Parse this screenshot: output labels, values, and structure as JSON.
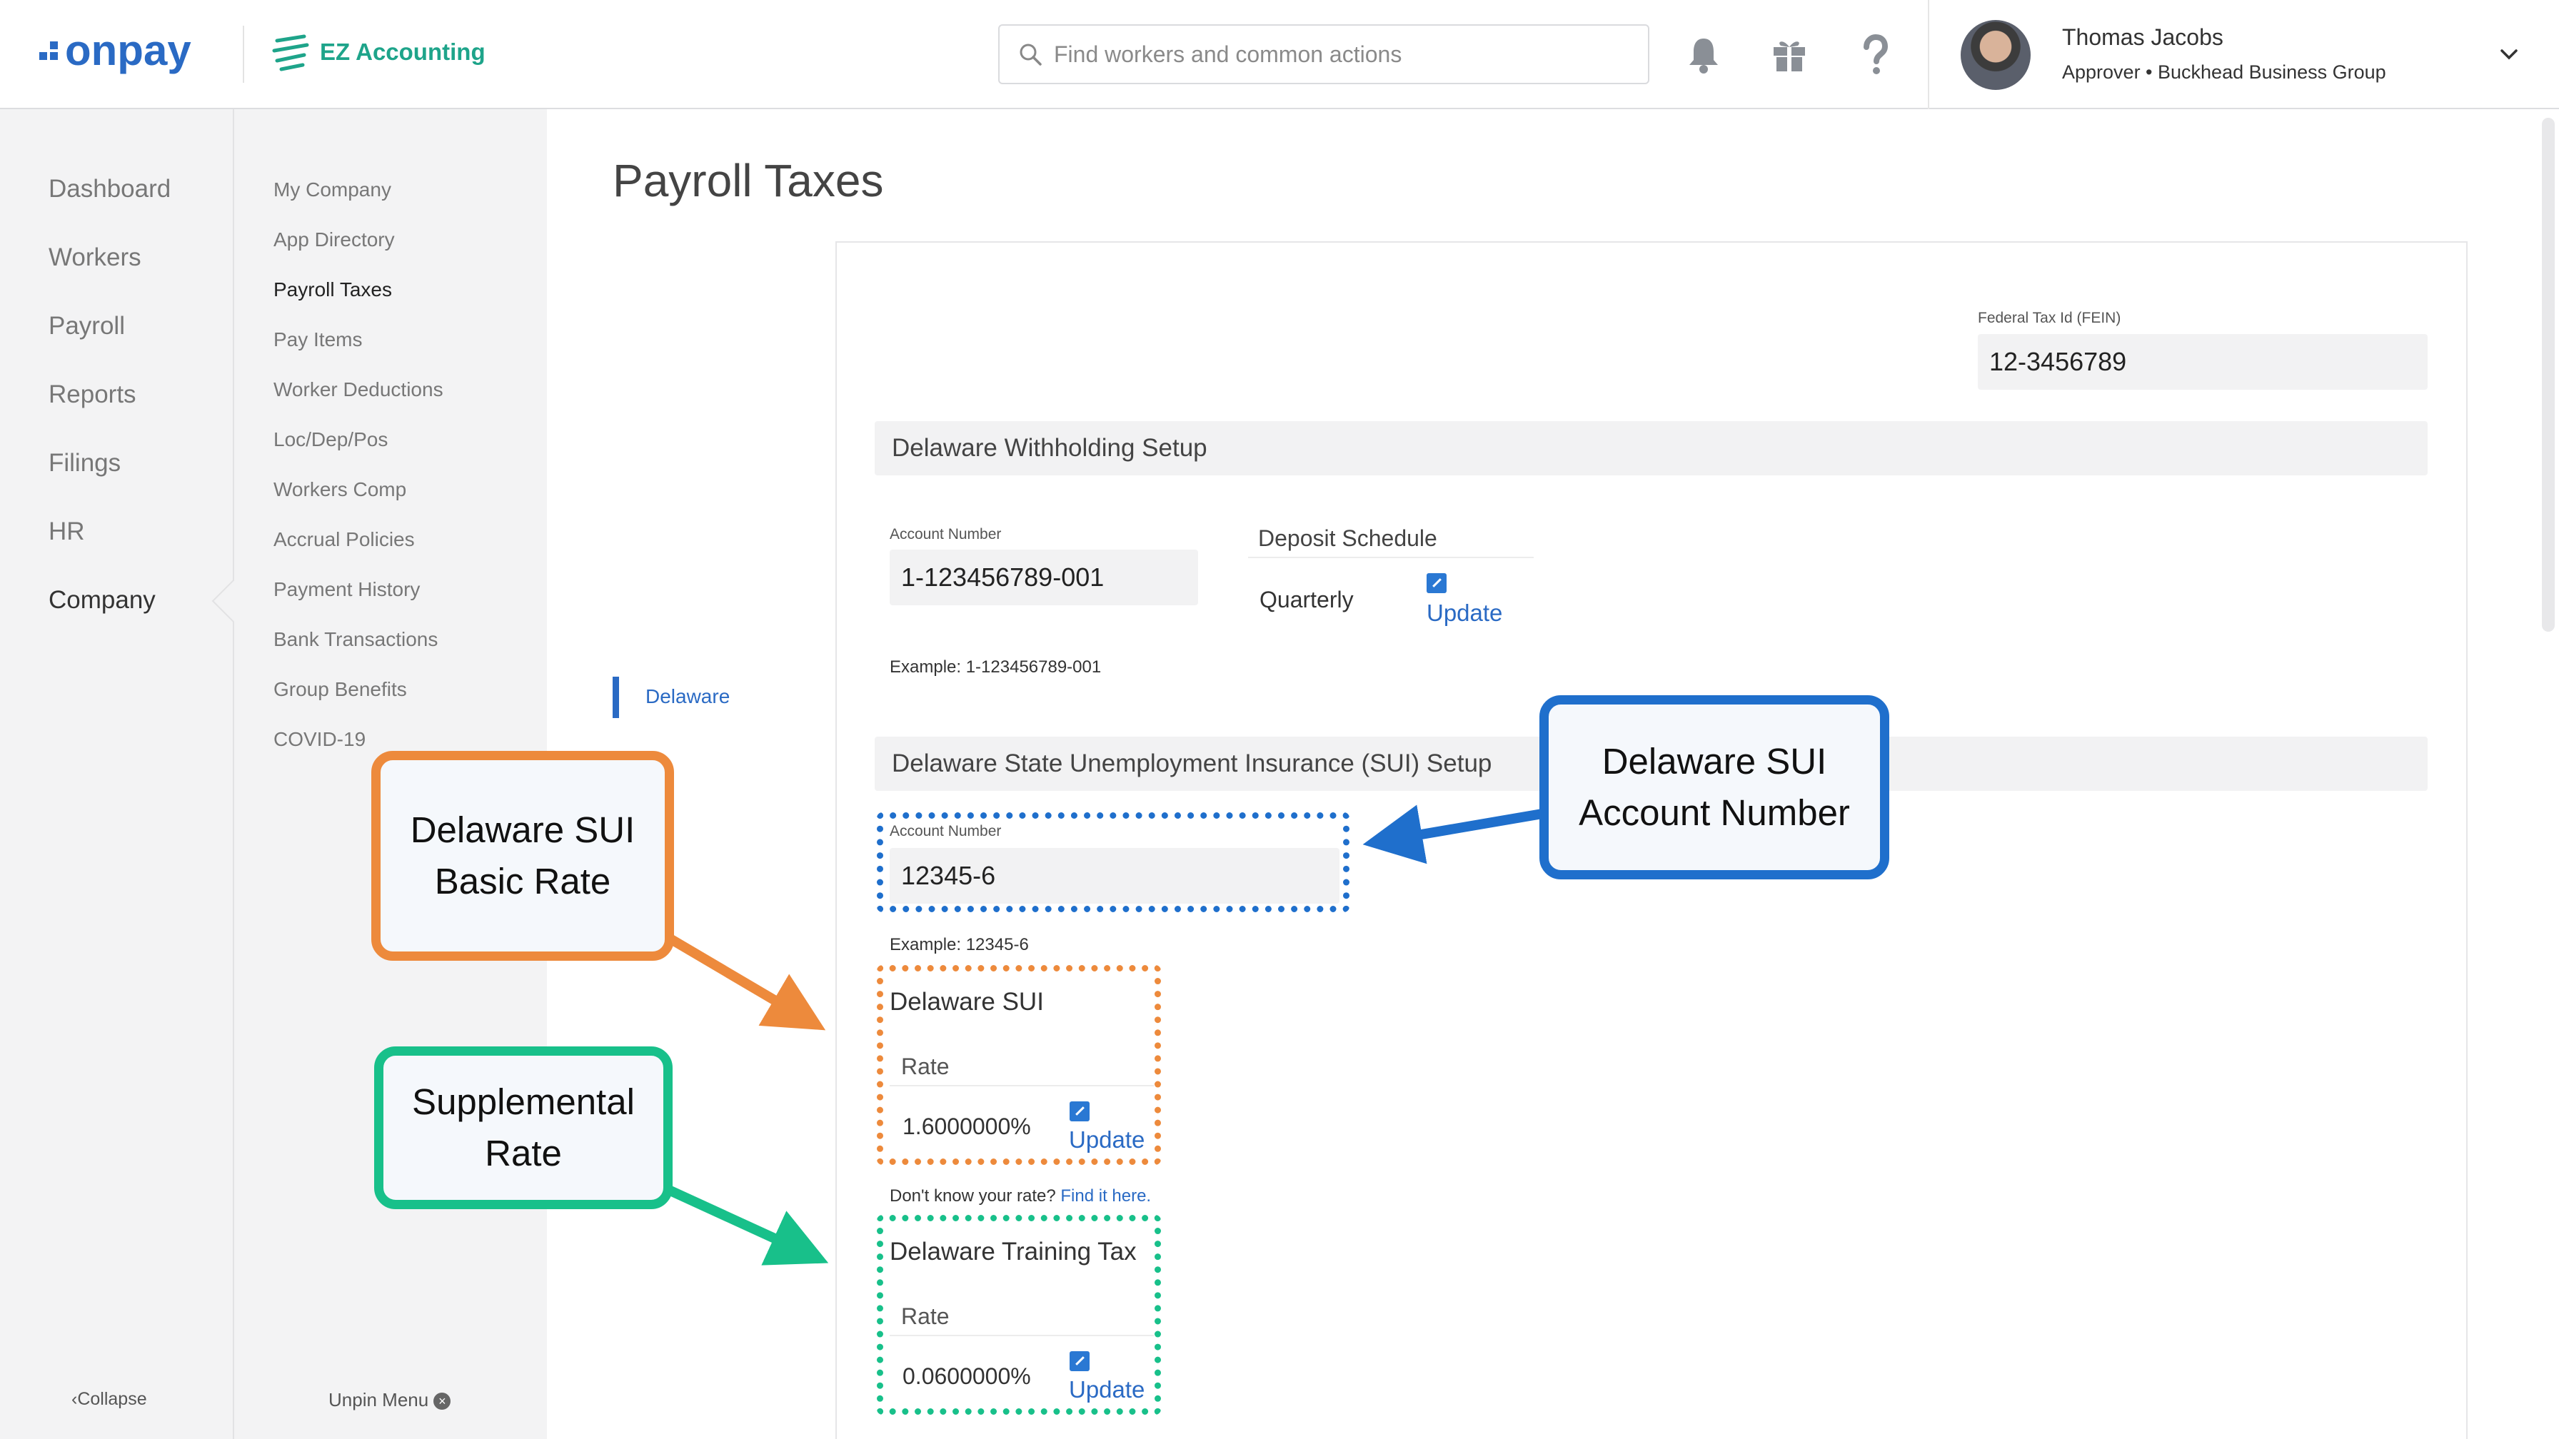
{
  "header": {
    "logo_text": "onpay",
    "ez_label": "EZ Accounting",
    "search_placeholder": "Find workers and common actions",
    "user_name": "Thomas Jacobs",
    "user_role": "Approver • Buckhead Business Group",
    "icons": [
      "bell-icon",
      "gift-icon",
      "help-icon",
      "chevron-down-icon"
    ]
  },
  "nav_primary": [
    "Dashboard",
    "Workers",
    "Payroll",
    "Reports",
    "Filings",
    "HR",
    "Company"
  ],
  "nav_primary_active": "Company",
  "nav_secondary": [
    "My Company",
    "App Directory",
    "Payroll Taxes",
    "Pay Items",
    "Worker Deductions",
    "Loc/Dep/Pos",
    "Workers Comp",
    "Accrual Policies",
    "Payment History",
    "Bank Transactions",
    "Group Benefits",
    "COVID-19"
  ],
  "nav_secondary_active": "Payroll Taxes",
  "footer": {
    "collapse": "Collapse",
    "unpin": "Unpin Menu"
  },
  "page": {
    "title": "Payroll Taxes",
    "state_tab": "Delaware",
    "fein_label": "Federal Tax Id (FEIN)",
    "fein_value": "12-3456789",
    "withholding": {
      "title": "Delaware Withholding Setup",
      "account_label": "Account Number",
      "account_value": "1-123456789-001",
      "example": "Example: 1-123456789-001",
      "deposit_label": "Deposit Schedule",
      "deposit_value": "Quarterly",
      "update": "Update"
    },
    "sui": {
      "title": "Delaware State Unemployment Insurance (SUI) Setup",
      "account_label": "Account Number",
      "account_value": "12345-6",
      "example": "Example: 12345-6",
      "sui_title": "Delaware SUI",
      "rate_label": "Rate",
      "rate_value": "1.6000000%",
      "update": "Update",
      "dont_know": "Don't know your rate?",
      "find_link": "Find it here.",
      "training_title": "Delaware Training Tax",
      "training_rate_label": "Rate",
      "training_rate_value": "0.0600000%",
      "training_update": "Update"
    }
  },
  "callouts": {
    "account": {
      "line1": "Delaware SUI",
      "line2": "Account Number",
      "color": "#1f6fcc"
    },
    "basic": {
      "line1": "Delaware SUI",
      "line2": "Basic Rate",
      "color": "#ed8a3c"
    },
    "supplemental": {
      "line1": "Supplemental",
      "line2": "Rate",
      "color": "#18c08a"
    }
  }
}
